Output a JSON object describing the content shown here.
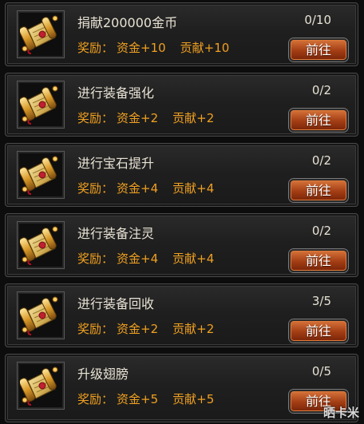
{
  "tasks": [
    {
      "title": "捐献200000金币",
      "progress": "0/10",
      "reward_label": "奖励：",
      "fund": "资金+10",
      "contribution": "贡献+10",
      "button": "前往"
    },
    {
      "title": "进行装备强化",
      "progress": "0/2",
      "reward_label": "奖励：",
      "fund": "资金+2",
      "contribution": "贡献+2",
      "button": "前往"
    },
    {
      "title": "进行宝石提升",
      "progress": "0/2",
      "reward_label": "奖励：",
      "fund": "资金+4",
      "contribution": "贡献+4",
      "button": "前往"
    },
    {
      "title": "进行装备注灵",
      "progress": "0/2",
      "reward_label": "奖励：",
      "fund": "资金+4",
      "contribution": "贡献+4",
      "button": "前往"
    },
    {
      "title": "进行装备回收",
      "progress": "3/5",
      "reward_label": "奖励：",
      "fund": "资金+2",
      "contribution": "贡献+2",
      "button": "前往"
    },
    {
      "title": "升级翅膀",
      "progress": "0/5",
      "reward_label": "奖励：",
      "fund": "资金+5",
      "contribution": "贡献+5",
      "button": "前往"
    }
  ],
  "icon": "scroll-icon",
  "watermark": "晒卡米",
  "colors": {
    "title": "#e8e2d4",
    "reward": "#f0a020",
    "button": "#b04818",
    "card": "#222222"
  }
}
